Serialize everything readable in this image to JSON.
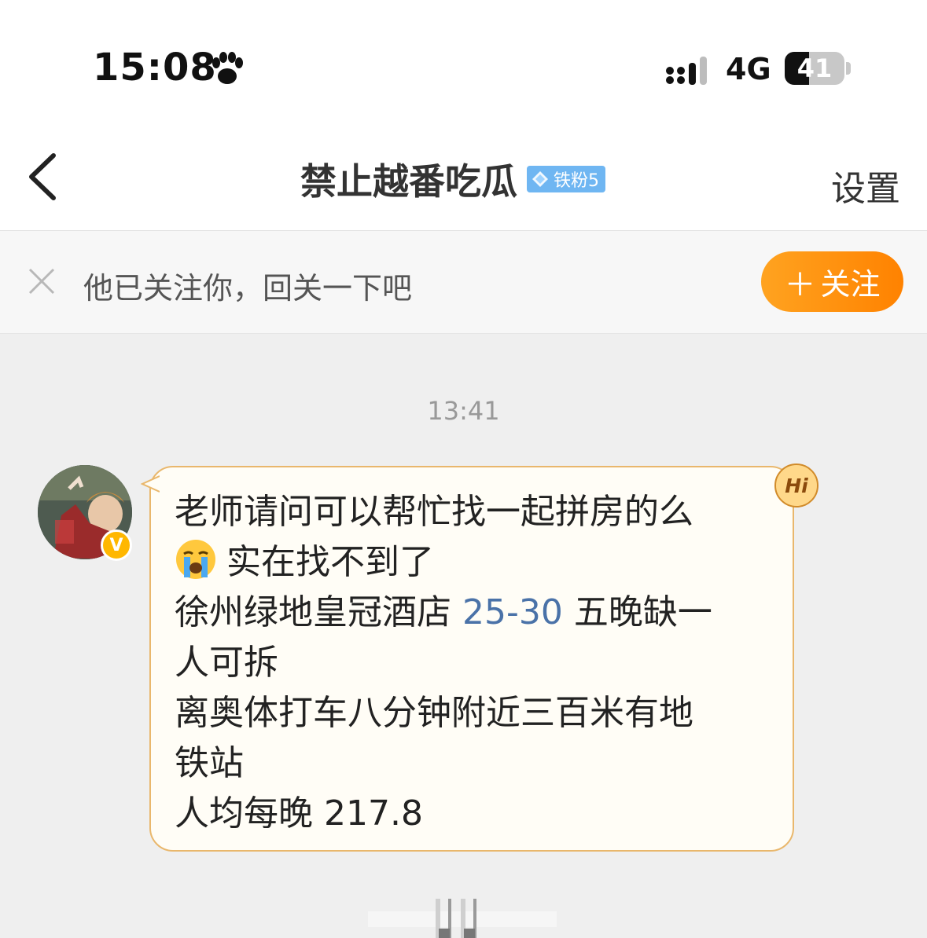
{
  "status_bar": {
    "time": "15:08",
    "network": "4G",
    "battery_level": "41",
    "battery_fraction": 0.41
  },
  "nav": {
    "title": "禁止越番吃瓜",
    "fan_badge": "铁粉5",
    "settings_label": "设置",
    "icons": {
      "back": "chevron-left-icon",
      "badge": "diamond-icon"
    }
  },
  "follow_prompt": {
    "text": "他已关注你，回关一下吧",
    "button_label": "关注",
    "button_plus": "＋",
    "icons": {
      "dismiss": "close-icon"
    }
  },
  "chat": {
    "timestamp": "13:41",
    "message": {
      "line1": "老师请问可以帮忙找一起拼房的么",
      "line2": "实在找不到了",
      "line3_before": "徐州绿地皇冠酒店 ",
      "line3_link": "25-30",
      "line3_after": " 五晚缺一",
      "line4": "人可拆",
      "line5": "离奥体打车八分钟附近三百米有地",
      "line6": "铁站",
      "line7": "人均每晚 217.8"
    },
    "hi_badge": "Hi",
    "icons": {
      "emoji": "crying-face-icon",
      "verified": "verified-v-icon"
    }
  },
  "colors": {
    "accent_orange": "#ff8a00",
    "bubble_border": "#e9b76c",
    "bubble_fill": "#fffdf6",
    "link_blue": "#4a72a8",
    "badge_blue": "#6fb6f2",
    "verified_gold": "#ffb700"
  }
}
